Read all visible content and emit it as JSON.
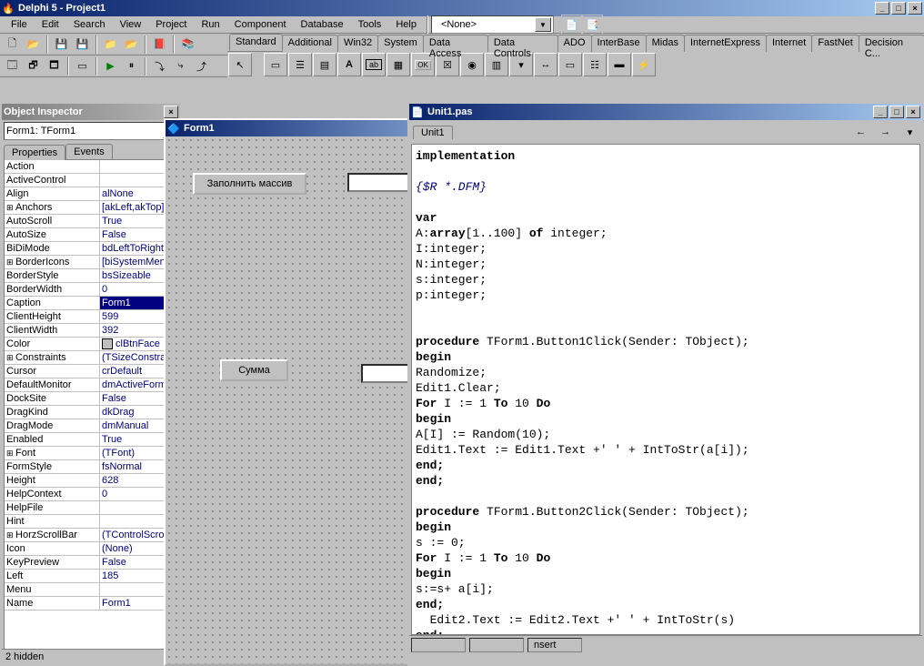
{
  "app": {
    "title": "Delphi 5 - Project1"
  },
  "menu": [
    "File",
    "Edit",
    "Search",
    "View",
    "Project",
    "Run",
    "Component",
    "Database",
    "Tools",
    "Help"
  ],
  "combo": {
    "value": "<None>"
  },
  "paletteTabs": [
    "Standard",
    "Additional",
    "Win32",
    "System",
    "Data Access",
    "Data Controls",
    "ADO",
    "InterBase",
    "Midas",
    "InternetExpress",
    "Internet",
    "FastNet",
    "Decision C..."
  ],
  "objInspector": {
    "title": "Object Inspector",
    "selector": "Form1: TForm1",
    "tabs": [
      "Properties",
      "Events"
    ],
    "status": "2 hidden",
    "rows": [
      {
        "n": "Action",
        "v": ""
      },
      {
        "n": "ActiveControl",
        "v": ""
      },
      {
        "n": "Align",
        "v": "alNone"
      },
      {
        "n": "Anchors",
        "v": "[akLeft,akTop]",
        "expand": true
      },
      {
        "n": "AutoScroll",
        "v": "True"
      },
      {
        "n": "AutoSize",
        "v": "False"
      },
      {
        "n": "BiDiMode",
        "v": "bdLeftToRight"
      },
      {
        "n": "BorderIcons",
        "v": "[biSystemMenu",
        "expand": true
      },
      {
        "n": "BorderStyle",
        "v": "bsSizeable"
      },
      {
        "n": "BorderWidth",
        "v": "0"
      },
      {
        "n": "Caption",
        "v": "Form1",
        "selected": true
      },
      {
        "n": "ClientHeight",
        "v": "599"
      },
      {
        "n": "ClientWidth",
        "v": "392"
      },
      {
        "n": "Color",
        "v": "clBtnFace",
        "color": true
      },
      {
        "n": "Constraints",
        "v": "(TSizeConstrair",
        "expand": true
      },
      {
        "n": "Cursor",
        "v": "crDefault"
      },
      {
        "n": "DefaultMonitor",
        "v": "dmActiveForm"
      },
      {
        "n": "DockSite",
        "v": "False"
      },
      {
        "n": "DragKind",
        "v": "dkDrag"
      },
      {
        "n": "DragMode",
        "v": "dmManual"
      },
      {
        "n": "Enabled",
        "v": "True"
      },
      {
        "n": "Font",
        "v": "(TFont)",
        "expand": true
      },
      {
        "n": "FormStyle",
        "v": "fsNormal"
      },
      {
        "n": "Height",
        "v": "628"
      },
      {
        "n": "HelpContext",
        "v": "0"
      },
      {
        "n": "HelpFile",
        "v": ""
      },
      {
        "n": "Hint",
        "v": ""
      },
      {
        "n": "HorzScrollBar",
        "v": "(TControlScrollB",
        "expand": true
      },
      {
        "n": "Icon",
        "v": "(None)"
      },
      {
        "n": "KeyPreview",
        "v": "False"
      },
      {
        "n": "Left",
        "v": "185"
      },
      {
        "n": "Menu",
        "v": ""
      },
      {
        "n": "Name",
        "v": "Form1"
      }
    ]
  },
  "form": {
    "title": "Form1",
    "button1": "Заполнить массив",
    "button2": "Сумма"
  },
  "editor": {
    "title": "Unit1.pas",
    "tab": "Unit1",
    "status_insert": "nsert",
    "lines": [
      {
        "t": "implementation",
        "kw": true
      },
      {
        "t": ""
      },
      {
        "t": "{$R *.DFM}",
        "cm": true
      },
      {
        "t": ""
      },
      {
        "t": "var",
        "kw": true
      },
      {
        "t": "A:array[1..100] of integer;",
        "mix": [
          [
            "A:",
            ""
          ],
          [
            "array",
            "kw"
          ],
          [
            "[1..100] ",
            ""
          ],
          [
            "of",
            "kw"
          ],
          [
            " integer;",
            ""
          ]
        ]
      },
      {
        "t": "I:integer;"
      },
      {
        "t": "N:integer;"
      },
      {
        "t": "s:integer;"
      },
      {
        "t": "p:integer;"
      },
      {
        "t": ""
      },
      {
        "t": ""
      },
      {
        "t": "procedure TForm1.Button1Click(Sender: TObject);",
        "mix": [
          [
            "procedure",
            "kw"
          ],
          [
            " TForm1.Button1Click(Sender: TObject);",
            ""
          ]
        ]
      },
      {
        "t": "begin",
        "kw": true
      },
      {
        "t": "Randomize;"
      },
      {
        "t": "Edit1.Clear;"
      },
      {
        "t": "For I := 1 To 10 Do",
        "mix": [
          [
            "For",
            "kw"
          ],
          [
            " I := 1 ",
            ""
          ],
          [
            "To",
            "kw"
          ],
          [
            " 10 ",
            ""
          ],
          [
            "Do",
            "kw"
          ]
        ]
      },
      {
        "t": "begin",
        "kw": true
      },
      {
        "t": "A[I] := Random(10);"
      },
      {
        "t": "Edit1.Text := Edit1.Text +' ' + IntToStr(a[i]);"
      },
      {
        "t": "end;",
        "kw": true
      },
      {
        "t": "end;",
        "kw": true
      },
      {
        "t": ""
      },
      {
        "t": "procedure TForm1.Button2Click(Sender: TObject);",
        "mix": [
          [
            "procedure",
            "kw"
          ],
          [
            " TForm1.Button2Click(Sender: TObject);",
            ""
          ]
        ]
      },
      {
        "t": "begin",
        "kw": true
      },
      {
        "t": "s := 0;"
      },
      {
        "t": "For I := 1 To 10 Do",
        "mix": [
          [
            "For",
            "kw"
          ],
          [
            " I := 1 ",
            ""
          ],
          [
            "To",
            "kw"
          ],
          [
            " 10 ",
            ""
          ],
          [
            "Do",
            "kw"
          ]
        ]
      },
      {
        "t": "begin",
        "kw": true
      },
      {
        "t": "s:=s+ a[i];"
      },
      {
        "t": "end;",
        "kw": true
      },
      {
        "t": "  Edit2.Text := Edit2.Text +' ' + IntToStr(s)"
      },
      {
        "t": "end;",
        "kw": true
      }
    ]
  }
}
